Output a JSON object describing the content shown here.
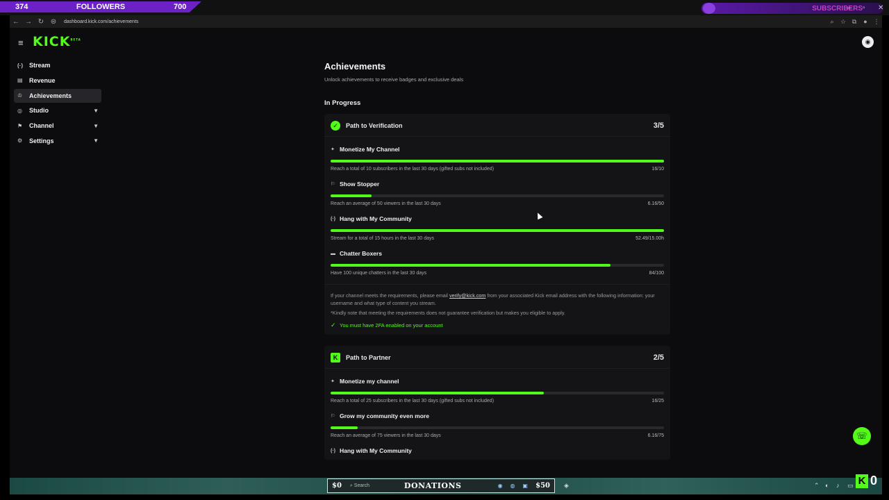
{
  "overlay": {
    "followers_left": "374",
    "followers_label": "FOLLOWERS",
    "followers_goal": "700",
    "subscribers_label": "SUBSCRIBERS"
  },
  "window_controls": {
    "minimize": "–",
    "maximize": "▫",
    "close": "✕"
  },
  "browser": {
    "url": "dashboard.kick.com/achievements",
    "back": "←",
    "forward": "→",
    "reload": "↻"
  },
  "app": {
    "logo": "KICK",
    "logo_tag": "BETA",
    "menu_icon": "≡"
  },
  "sidebar": {
    "items": [
      {
        "label": "Stream",
        "icon": "stream-icon",
        "glyph": "(·)",
        "expandable": false
      },
      {
        "label": "Revenue",
        "icon": "revenue-icon",
        "glyph": "▤",
        "expandable": false
      },
      {
        "label": "Achievements",
        "icon": "trophy-icon",
        "glyph": "🏆",
        "expandable": false,
        "active": true
      },
      {
        "label": "Studio",
        "icon": "studio-icon",
        "glyph": "◎",
        "expandable": true
      },
      {
        "label": "Channel",
        "icon": "channel-icon",
        "glyph": "⚑",
        "expandable": true
      },
      {
        "label": "Settings",
        "icon": "gear-icon",
        "glyph": "⚙",
        "expandable": true
      }
    ]
  },
  "main": {
    "title": "Achievements",
    "subtitle": "Unlock achievements to receive badges and exclusive deals",
    "section_in_progress": "In Progress",
    "verification": {
      "title": "Path to Verification",
      "count": "3/5",
      "achievements": [
        {
          "title": "Monetize My Channel",
          "glyph": "✦",
          "desc": "Reach a total of 10 subscribers in the last 30 days (gifted subs not included)",
          "value": "16/10",
          "progress": 1.0
        },
        {
          "title": "Show Stopper",
          "glyph": "⚐",
          "desc": "Reach an average of 50 viewers in the last 30 days",
          "value": "6.16/50",
          "progress": 0.1232
        },
        {
          "title": "Hang with My Community",
          "glyph": "(·)",
          "desc": "Stream for a total of 15 hours in the last 30 days",
          "value": "52.49/15.00h",
          "progress": 1.0
        },
        {
          "title": "Chatter Boxers",
          "glyph": "▬",
          "desc": "Have 100 unique chatters in the last 30 days",
          "value": "84/100",
          "progress": 0.84
        }
      ],
      "note_prefix": "If your channel meets the requirements, please email ",
      "note_email": "verify@kick.com",
      "note_suffix": " from your associated Kick email address with the following information: your username and what type of content you stream.",
      "note_disclaimer": "*Kindly note that meeting the requirements does not guarantee verification but makes you eligible to apply.",
      "requirement": "You must have 2FA enabled on your account"
    },
    "partner": {
      "title": "Path to Partner",
      "count": "2/5",
      "achievements": [
        {
          "title": "Monetize my channel",
          "glyph": "✦",
          "desc": "Reach a total of 25 subscribers in the last 30 days (gifted subs not included)",
          "value": "16/25",
          "progress": 0.64
        },
        {
          "title": "Grow my community even more",
          "glyph": "⚐",
          "desc": "Reach an average of 75 viewers in the last 30 days",
          "value": "6.16/75",
          "progress": 0.0821
        },
        {
          "title": "Hang with My Community",
          "glyph": "(·)",
          "desc": "",
          "value": "",
          "progress": 0
        }
      ]
    }
  },
  "taskbar": {
    "left_amount": "$0",
    "search_placeholder": "Search",
    "donations_label": "DONATIONS",
    "right_amount": "$50",
    "kick_count": "0"
  },
  "colors": {
    "accent": "#53fc18",
    "background": "#0c0c0e",
    "card": "#141416"
  }
}
